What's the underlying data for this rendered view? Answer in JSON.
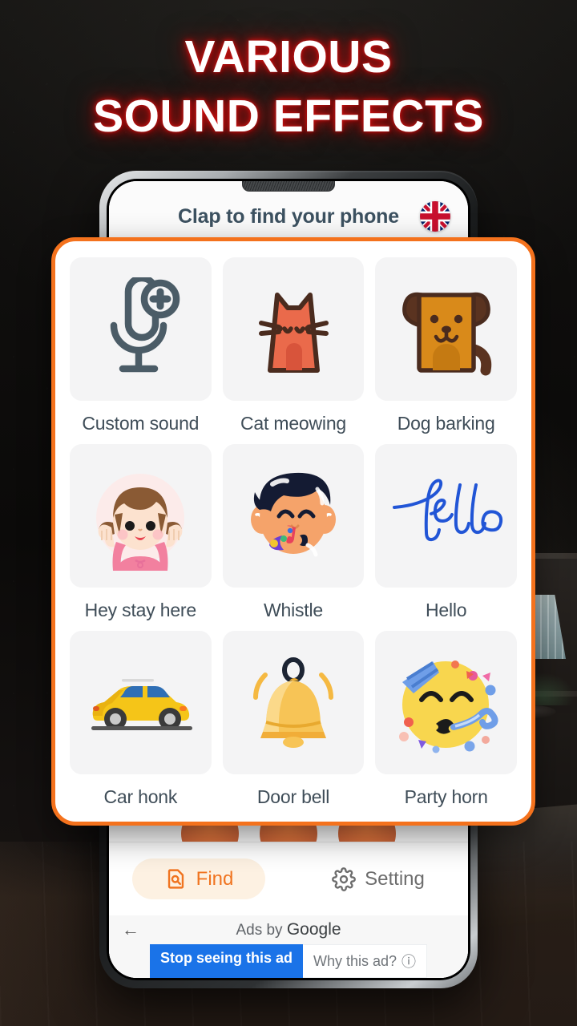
{
  "promo": {
    "headline_line1": "VARIOUS",
    "headline_line2": "SOUND EFFECTS",
    "headline_glow_color": "#d11010",
    "headline_color": "#ffffff"
  },
  "app": {
    "header": {
      "title": "Clap to find your phone",
      "title_color": "#3c5160",
      "language_flag": "uk-flag-icon"
    },
    "accent_color": "#f4721d",
    "tile_background": "#f4f4f5",
    "label_color": "#3f4d58",
    "sounds": [
      {
        "label": "Custom sound",
        "icon": "microphone-plus-icon"
      },
      {
        "label": "Cat meowing",
        "icon": "cat-icon"
      },
      {
        "label": "Dog barking",
        "icon": "dog-icon"
      },
      {
        "label": "Hey stay here",
        "icon": "girl-waving-icon"
      },
      {
        "label": "Whistle",
        "icon": "boy-whistling-icon"
      },
      {
        "label": "Hello",
        "icon": "hello-script-icon"
      },
      {
        "label": "Car honk",
        "icon": "yellow-car-icon"
      },
      {
        "label": "Door bell",
        "icon": "bell-icon"
      },
      {
        "label": "Party horn",
        "icon": "party-face-icon"
      }
    ],
    "bottom_nav": [
      {
        "label": "Find",
        "icon": "find-document-search-icon",
        "active": true,
        "color": "#f07420"
      },
      {
        "label": "Setting",
        "icon": "gear-icon",
        "active": false,
        "color": "#6d6d6d"
      }
    ]
  },
  "ad": {
    "back_glyph": "←",
    "attribution_prefix": "Ads by ",
    "attribution_brand": "Google",
    "stop_label": "Stop seeing this ad",
    "why_label": "Why this ad?",
    "why_info_glyph": "ⓘ",
    "stop_color": "#1a73e8"
  }
}
